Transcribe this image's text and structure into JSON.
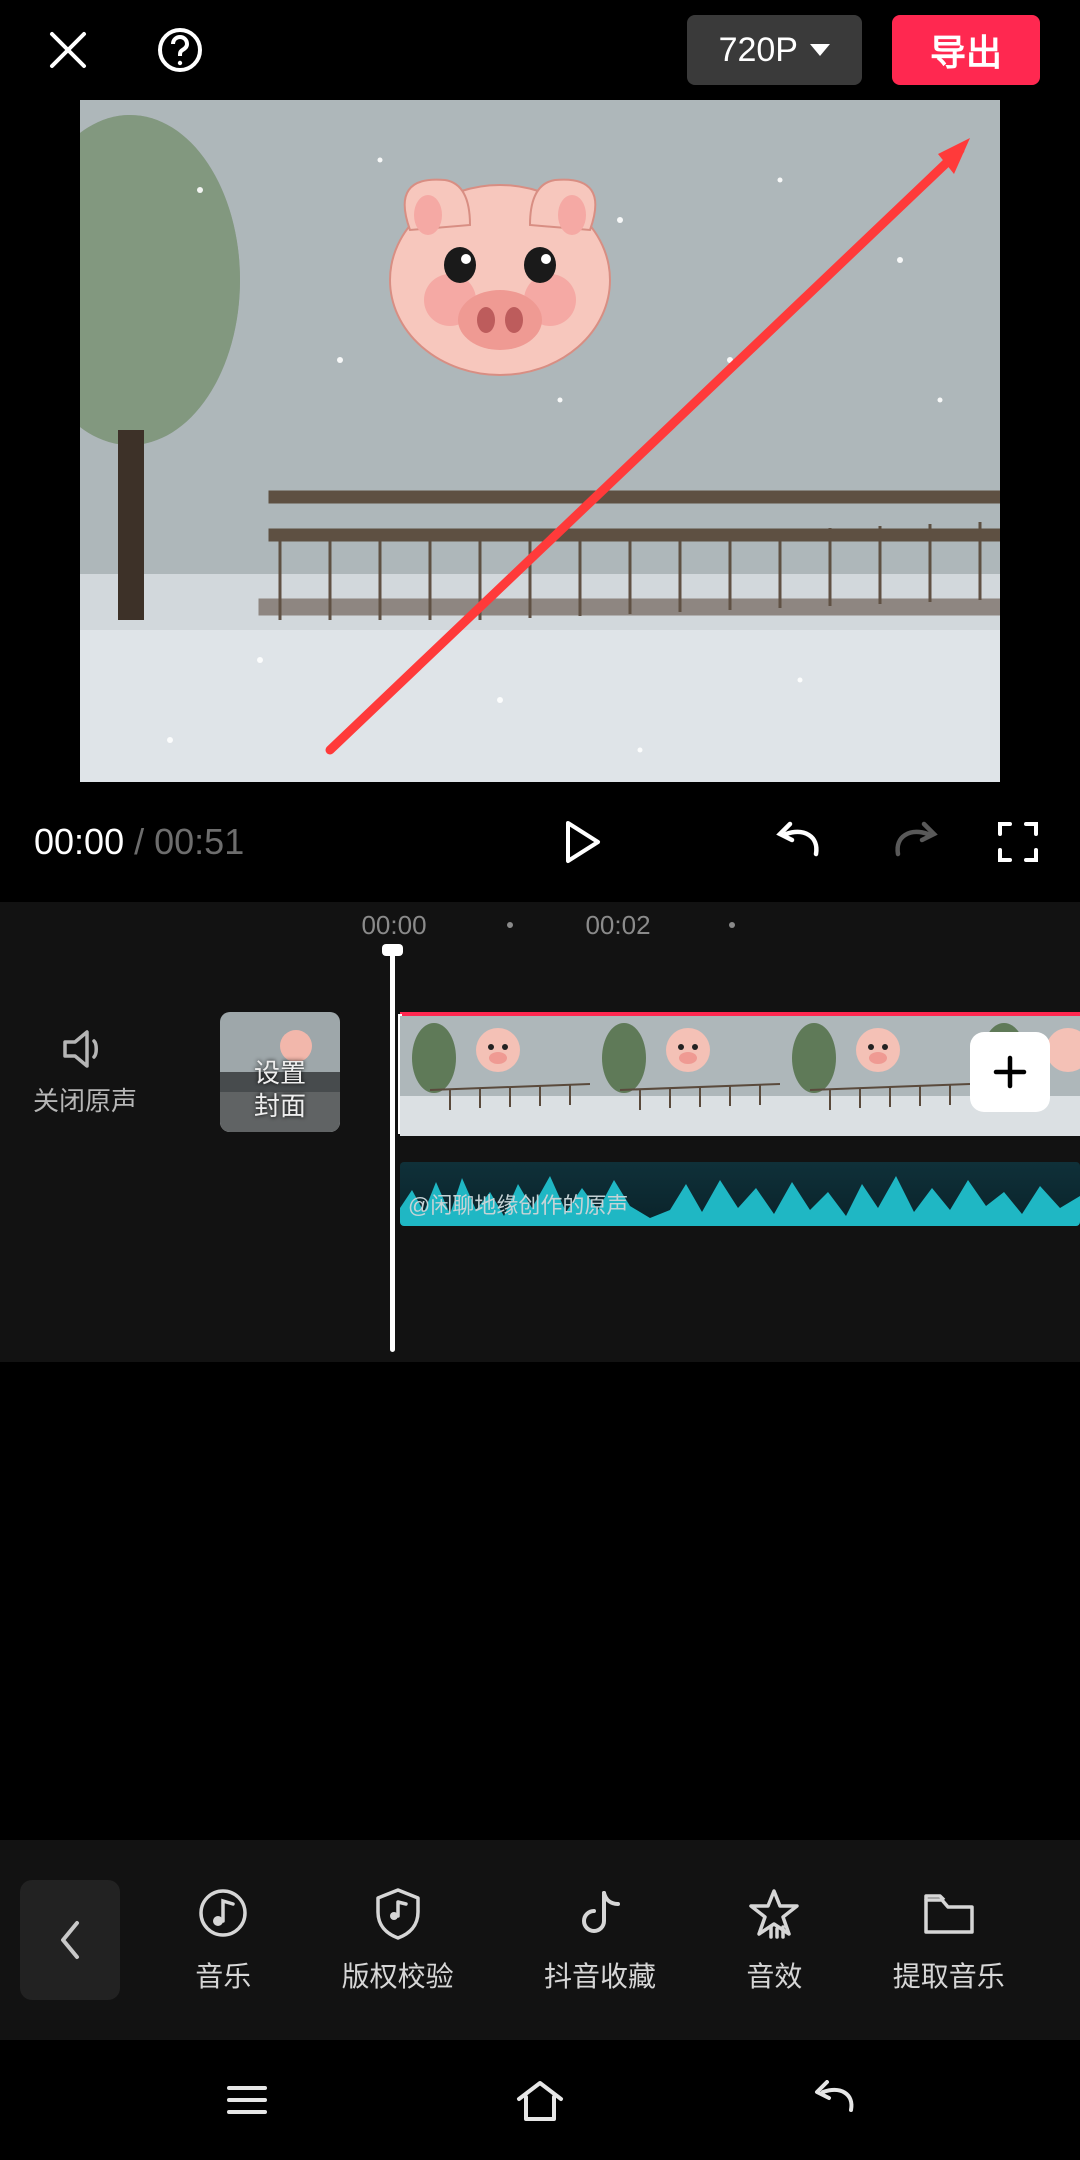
{
  "header": {
    "resolution_label": "720P",
    "export_label": "导出"
  },
  "playback": {
    "current_time": "00:00",
    "duration": "00:51"
  },
  "timeline": {
    "tick_labels": [
      "00:00",
      "00:02"
    ],
    "mute_label": "关闭原声",
    "cover_label_line1": "设置",
    "cover_label_line2": "封面",
    "audio_track_label": "@闲聊地缘创作的原声"
  },
  "toolbar": {
    "items": [
      {
        "label": "音乐",
        "icon": "music-note-icon"
      },
      {
        "label": "版权校验",
        "icon": "shield-icon"
      },
      {
        "label": "抖音收藏",
        "icon": "douyin-icon"
      },
      {
        "label": "音效",
        "icon": "star-icon"
      },
      {
        "label": "提取音乐",
        "icon": "folder-icon"
      }
    ]
  }
}
